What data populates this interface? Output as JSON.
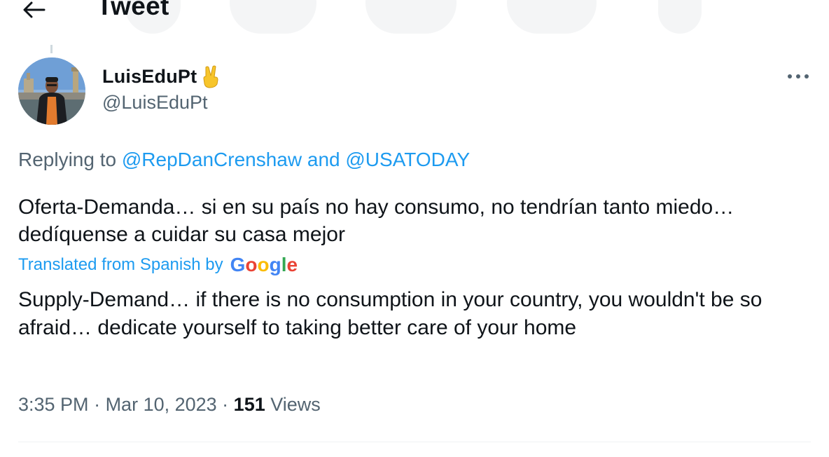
{
  "header": {
    "title": "Tweet",
    "back_icon": "arrow-left-icon"
  },
  "author": {
    "display_name": "LuisEduPt",
    "emoji": "victory-hand-emoji",
    "handle": "@LuisEduPt",
    "avatar": "profile-photo"
  },
  "more_icon": "ellipsis-icon",
  "reply": {
    "prefix": "Replying to ",
    "mention_1": "@RepDanCrenshaw",
    "conjunction": " and ",
    "mention_2": "@USATODAY"
  },
  "tweet": {
    "text": "Oferta-Demanda… si en su país no hay consumo, no tendrían tanto miedo… dedíquense a cuidar su casa mejor",
    "translated_label": "Translated from Spanish by",
    "translation": "Supply-Demand… if there is no consumption in your country, you wouldn't be so afraid… dedicate yourself to taking better care of your home"
  },
  "meta": {
    "time": "3:35 PM",
    "separator": " · ",
    "date": "Mar 10, 2023",
    "views_count": "151",
    "views_label": " Views"
  },
  "colors": {
    "accent": "#1d9bf0",
    "text_primary": "#0f1419",
    "text_secondary": "#536471",
    "divider": "#eff3f4"
  }
}
